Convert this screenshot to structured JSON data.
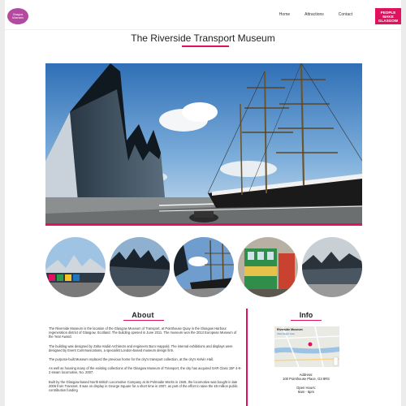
{
  "nav": {
    "logo_text_1": "Glasgow",
    "logo_text_2": "Museums",
    "links": [
      "Home",
      "Attractions",
      "Contact"
    ],
    "brand_lines": [
      "PEOPLE",
      "MAKE",
      "GLASGOW"
    ],
    "accent": "#e0115f"
  },
  "page_title": "The Riverside Transport Museum",
  "about": {
    "heading": "About",
    "paragraphs": [
      "The Riverside Museum is the location of the Glasgow Museum of Transport, at Pointhouse Quay in the Glasgow Harbour regeneration district of Glasgow, Scotland. The building opened in June 2011. The museum won the 2013 European Museum of the Year Award.",
      "The building was designed by Zaha Hadid Architects and engineers Buro Happold. The internal exhibitions and displays were designed by Event Communications, a specialist London-based museum design firm.",
      "The purpose-built Museum replaced the previous home for the city's transport collection, at the city's Kelvin Hall.",
      "As well as housing many of the existing collections of the Glasgow Museum of Transport, the city has acquired SAR Class 15F 4-8-2 steam locomotive, No. 2007.",
      "Built by the Glasgow-based North British Locomotive Company at its Polmadie Works in 1945, the locomotive was bought in late 2006 from Transnet. It was on display in George Square for a short time in 2007, as part of the effort to raise the £5 million public contribution funding"
    ]
  },
  "info": {
    "heading": "Info",
    "map_label": "Riverside Museum",
    "map_sub": "View larger map",
    "address_label": "Address:",
    "address_value": "100 Pointhouse Place, G3 8RS",
    "hours_label": "Open Hours:",
    "hours_value": "8am - 6pm"
  }
}
